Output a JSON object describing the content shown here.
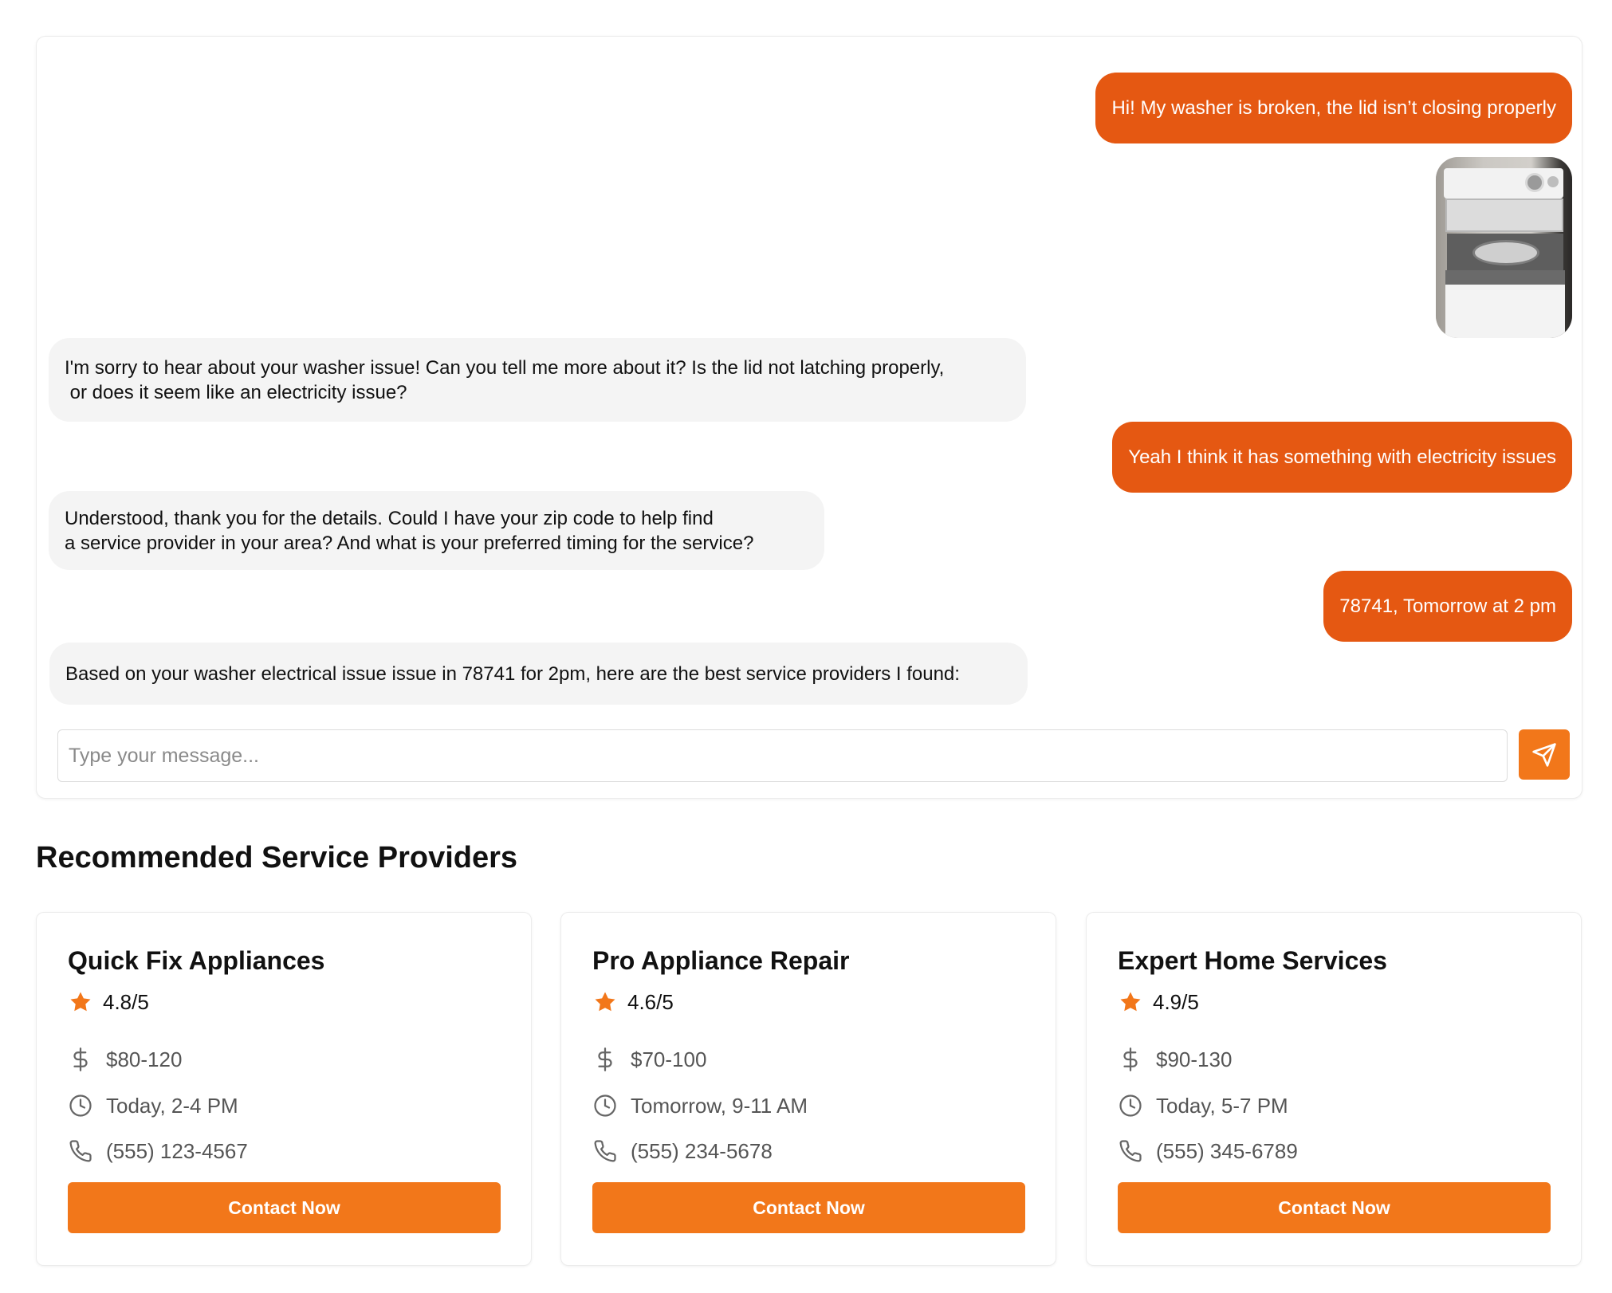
{
  "chat": {
    "messages": [
      {
        "role": "user",
        "text": "Hi! My washer is broken, the lid isn’t closing properly"
      },
      {
        "role": "user",
        "type": "image",
        "image_icon": "washer-photo"
      },
      {
        "role": "bot",
        "lines": [
          "I'm sorry to hear about your washer issue! Can you tell me more about it? Is the lid not latching properly,",
          " or does it seem like an electricity issue?"
        ]
      },
      {
        "role": "user",
        "text": "Yeah I think it has something with electricity issues"
      },
      {
        "role": "bot",
        "lines": [
          "Understood, thank you for the details. Could I have your zip code to help find",
          "a service provider in your area? And what is your preferred timing for the service?"
        ]
      },
      {
        "role": "user",
        "text": "78741, Tomorrow at 2 pm"
      },
      {
        "role": "bot",
        "lines": [
          "Based on your washer electrical issue issue in 78741 for 2pm, here are the best service providers I found:"
        ]
      }
    ],
    "input_placeholder": "Type your message...",
    "send_icon": "send-icon"
  },
  "providers": {
    "title": "Recommended Service Providers",
    "cards": [
      {
        "name": "Quick Fix Appliances",
        "rating": "4.8/5",
        "price": "$80-120",
        "availability": "Today, 2-4 PM",
        "phone": "(555) 123-4567",
        "button": "Contact Now"
      },
      {
        "name": "Pro Appliance Repair",
        "rating": "4.6/5",
        "price": "$70-100",
        "availability": "Tomorrow, 9-11 AM",
        "phone": "(555) 234-5678",
        "button": "Contact Now"
      },
      {
        "name": "Expert Home Services",
        "rating": "4.9/5",
        "price": "$90-130",
        "availability": "Today, 5-7 PM",
        "phone": "(555) 345-6789",
        "button": "Contact Now"
      }
    ]
  },
  "colors": {
    "user_bubble": "#e55812",
    "bot_bubble": "#f4f4f4",
    "accent": "#f2771a",
    "star": "#f2771a"
  },
  "icons": {
    "star": "star-icon",
    "price": "dollar-icon",
    "time": "clock-icon",
    "phone": "phone-icon"
  }
}
